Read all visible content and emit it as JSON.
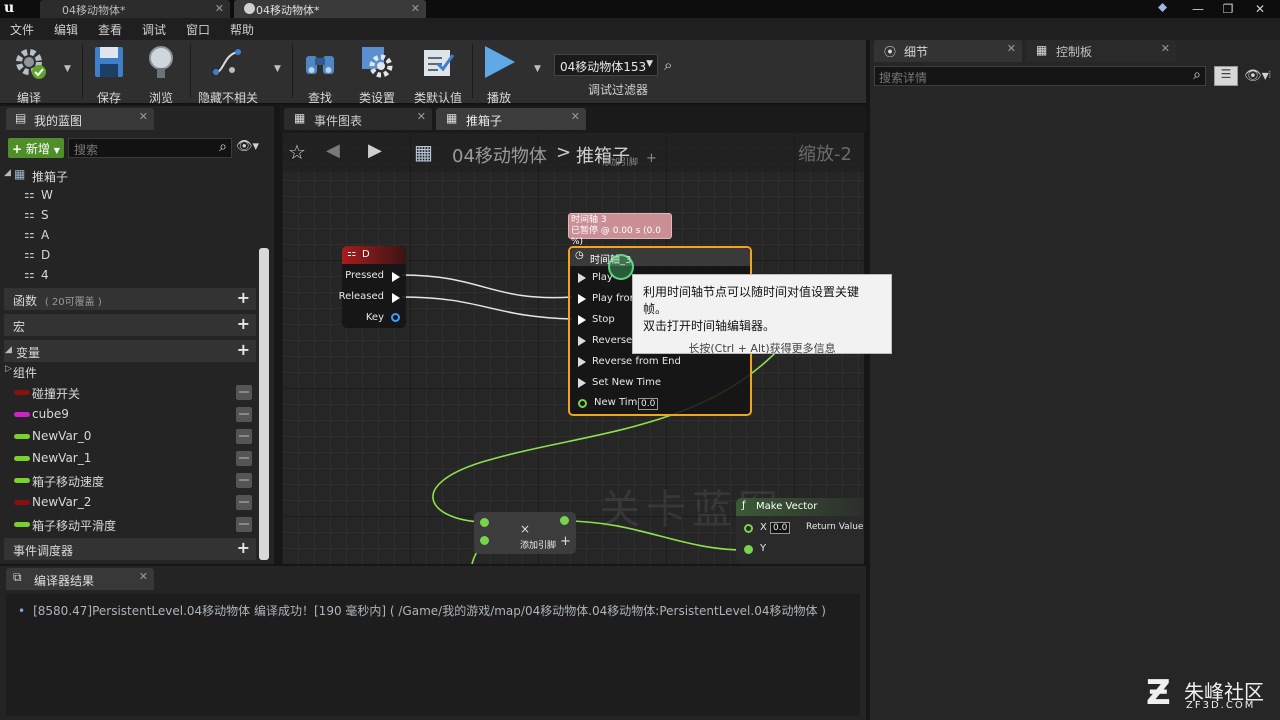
{
  "titlebar": {
    "tabs": [
      {
        "label": "04移动物体*",
        "active": false
      },
      {
        "label": "04移动物体*",
        "active": true
      }
    ]
  },
  "menu": [
    "文件",
    "编辑",
    "查看",
    "调试",
    "窗口",
    "帮助"
  ],
  "toolbar": {
    "compile": "编译",
    "save": "保存",
    "browse": "浏览",
    "hide_unrelated": "隐藏不相关",
    "find": "查找",
    "class_settings": "类设置",
    "class_defaults": "类默认值",
    "play": "播放",
    "debug_object": "04移动物体153",
    "debug_filter": "调试过滤器"
  },
  "right_panel": {
    "tabs": [
      "细节",
      "控制板"
    ],
    "search_placeholder": "搜索详情"
  },
  "my_blueprint": {
    "tab": "我的蓝图",
    "new_button": "新增",
    "search_placeholder": "搜索",
    "graph_root": "推箱子",
    "graph_items": [
      "W",
      "S",
      "A",
      "D",
      "4"
    ],
    "functions": "函数",
    "functions_note": "( 20可覆盖 )",
    "macros": "宏",
    "variables": "变量",
    "components": "组件",
    "vars": [
      {
        "name": "碰撞开关",
        "color": "#8a1010"
      },
      {
        "name": "cube9",
        "color": "#d020c8"
      },
      {
        "name": "NewVar_0",
        "color": "#7ad12c"
      },
      {
        "name": "NewVar_1",
        "color": "#7ad12c"
      },
      {
        "name": "箱子移动速度",
        "color": "#7ad12c"
      },
      {
        "name": "NewVar_2",
        "color": "#8a1010"
      },
      {
        "name": "箱子移动平滑度",
        "color": "#7ad12c"
      }
    ],
    "event_dispatchers": "事件调度器"
  },
  "graph_tabs": [
    "事件图表",
    "推箱子"
  ],
  "graph": {
    "breadcrumb_root": "04移动物体",
    "breadcrumb_sep": ">",
    "breadcrumb_leaf": "推箱子",
    "zoom": "缩放-2",
    "watermark": "关卡蓝图",
    "add_pin_top": "添加引脚",
    "key_node": {
      "title": "D",
      "pins": [
        "Pressed",
        "Released",
        "Key"
      ]
    },
    "timeline_comment": "时间轴 3",
    "timeline_status": "已暂停 @ 0.00 s (0.0 %)",
    "timeline_node": {
      "title": "时间轴_3",
      "pins": [
        "Play",
        "Play from",
        "Stop",
        "Reverse",
        "Reverse from End",
        "Set New Time",
        "New Time"
      ],
      "new_time_value": "0.0"
    },
    "add_node": {
      "remove_glyph": "×",
      "label": "添加引脚"
    },
    "make_vector": {
      "title": "Make Vector",
      "x_label": "X",
      "x_value": "0.0",
      "y_label": "Y",
      "return": "Return Value"
    },
    "tooltip": {
      "line1": "利用时间轴节点可以随时间对值设置关键帧。",
      "line2": "双击打开时间轴编辑器。",
      "hint": "长按(Ctrl + Alt)获得更多信息"
    }
  },
  "compiler": {
    "tab": "编译器结果",
    "message": "[8580.47]PersistentLevel.04移动物体 编译成功！[190 毫秒内] ( /Game/我的游戏/map/04移动物体.04移动物体:PersistentLevel.04移动物体 )"
  },
  "watermark_logo": {
    "name": "朱峰社区",
    "url": "ZF3D.COM"
  }
}
